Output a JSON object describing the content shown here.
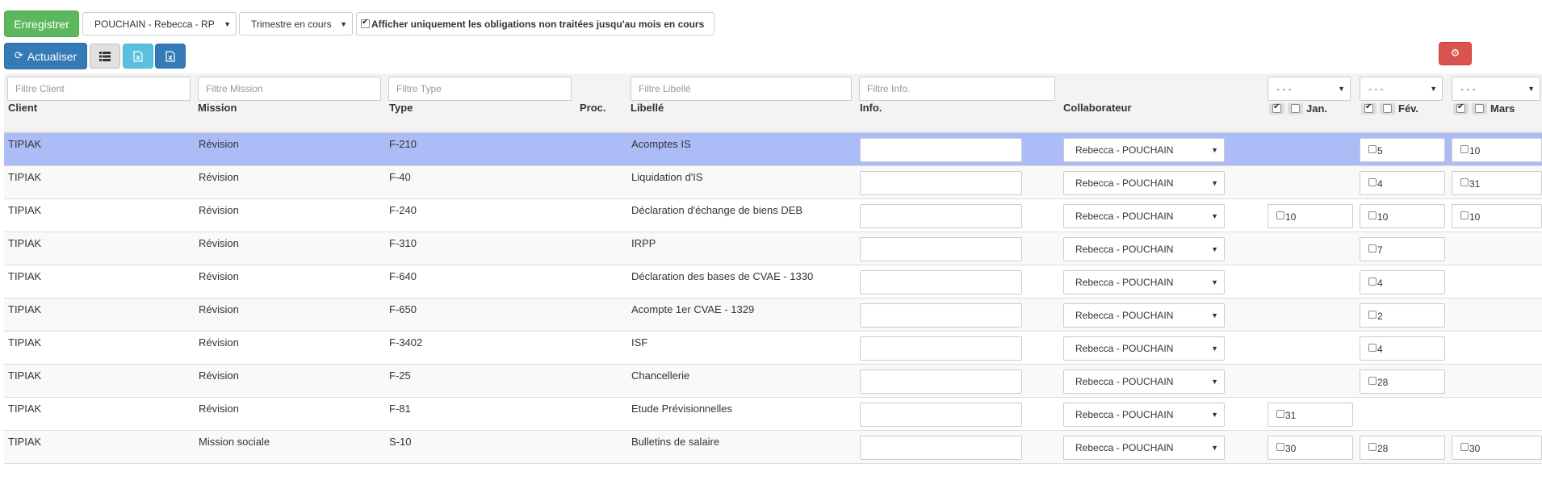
{
  "toolbar": {
    "save_label": "Enregistrer",
    "user_select": "POUCHAIN - Rebecca - RP",
    "period_select": "Trimestre en cours",
    "only_untreated_label": "Afficher uniquement les obligations non traitées jusqu'au mois en cours",
    "only_untreated_checked": true,
    "refresh_label": "Actualiser",
    "icons": [
      "refresh-icon",
      "list-icon",
      "excel-icon",
      "excel-icon",
      "gears-icon"
    ]
  },
  "filters": {
    "client": "Filtre Client",
    "mission": "Filtre Mission",
    "type": "Filtre Type",
    "libelle": "Filtre Libellé",
    "info": "Filtre Info."
  },
  "columns": {
    "client": "Client",
    "mission": "Mission",
    "type": "Type",
    "proc": "Proc.",
    "libelle": "Libellé",
    "info": "Info.",
    "collaborateur": "Collaborateur"
  },
  "months": [
    {
      "label": "Jan.",
      "select": "- - -"
    },
    {
      "label": "Fév.",
      "select": "- - -"
    },
    {
      "label": "Mars",
      "select": "- - -"
    }
  ],
  "rows": [
    {
      "client": "TIPIAK",
      "mission": "Révision",
      "type": "F-210",
      "libelle": "Acomptes IS",
      "collab": "Rebecca - POUCHAIN",
      "jan": "",
      "fev": "5",
      "mars": "10"
    },
    {
      "client": "TIPIAK",
      "mission": "Révision",
      "type": "F-40",
      "libelle": "Liquidation d'IS",
      "collab": "Rebecca - POUCHAIN",
      "jan": "",
      "fev": "4",
      "mars": "31"
    },
    {
      "client": "TIPIAK",
      "mission": "Révision",
      "type": "F-240",
      "libelle": "Déclaration d'échange de biens DEB",
      "collab": "Rebecca - POUCHAIN",
      "jan": "10",
      "fev": "10",
      "mars": "10"
    },
    {
      "client": "TIPIAK",
      "mission": "Révision",
      "type": "F-310",
      "libelle": "IRPP",
      "collab": "Rebecca - POUCHAIN",
      "jan": "",
      "fev": "7",
      "mars": ""
    },
    {
      "client": "TIPIAK",
      "mission": "Révision",
      "type": "F-640",
      "libelle": "Déclaration des bases de CVAE - 1330",
      "collab": "Rebecca - POUCHAIN",
      "jan": "",
      "fev": "4",
      "mars": ""
    },
    {
      "client": "TIPIAK",
      "mission": "Révision",
      "type": "F-650",
      "libelle": "Acompte 1er CVAE - 1329",
      "collab": "Rebecca - POUCHAIN",
      "jan": "",
      "fev": "2",
      "mars": ""
    },
    {
      "client": "TIPIAK",
      "mission": "Révision",
      "type": "F-3402",
      "libelle": "ISF",
      "collab": "Rebecca - POUCHAIN",
      "jan": "",
      "fev": "4",
      "mars": ""
    },
    {
      "client": "TIPIAK",
      "mission": "Révision",
      "type": "F-25",
      "libelle": "Chancellerie",
      "collab": "Rebecca - POUCHAIN",
      "jan": "",
      "fev": "28",
      "mars": ""
    },
    {
      "client": "TIPIAK",
      "mission": "Révision",
      "type": "F-81",
      "libelle": "Etude Prévisionnelles",
      "collab": "Rebecca - POUCHAIN",
      "jan": "31",
      "fev": "",
      "mars": ""
    },
    {
      "client": "TIPIAK",
      "mission": "Mission sociale",
      "type": "S-10",
      "libelle": "Bulletins de salaire",
      "collab": "Rebecca - POUCHAIN",
      "jan": "30",
      "fev": "28",
      "mars": "30"
    }
  ]
}
